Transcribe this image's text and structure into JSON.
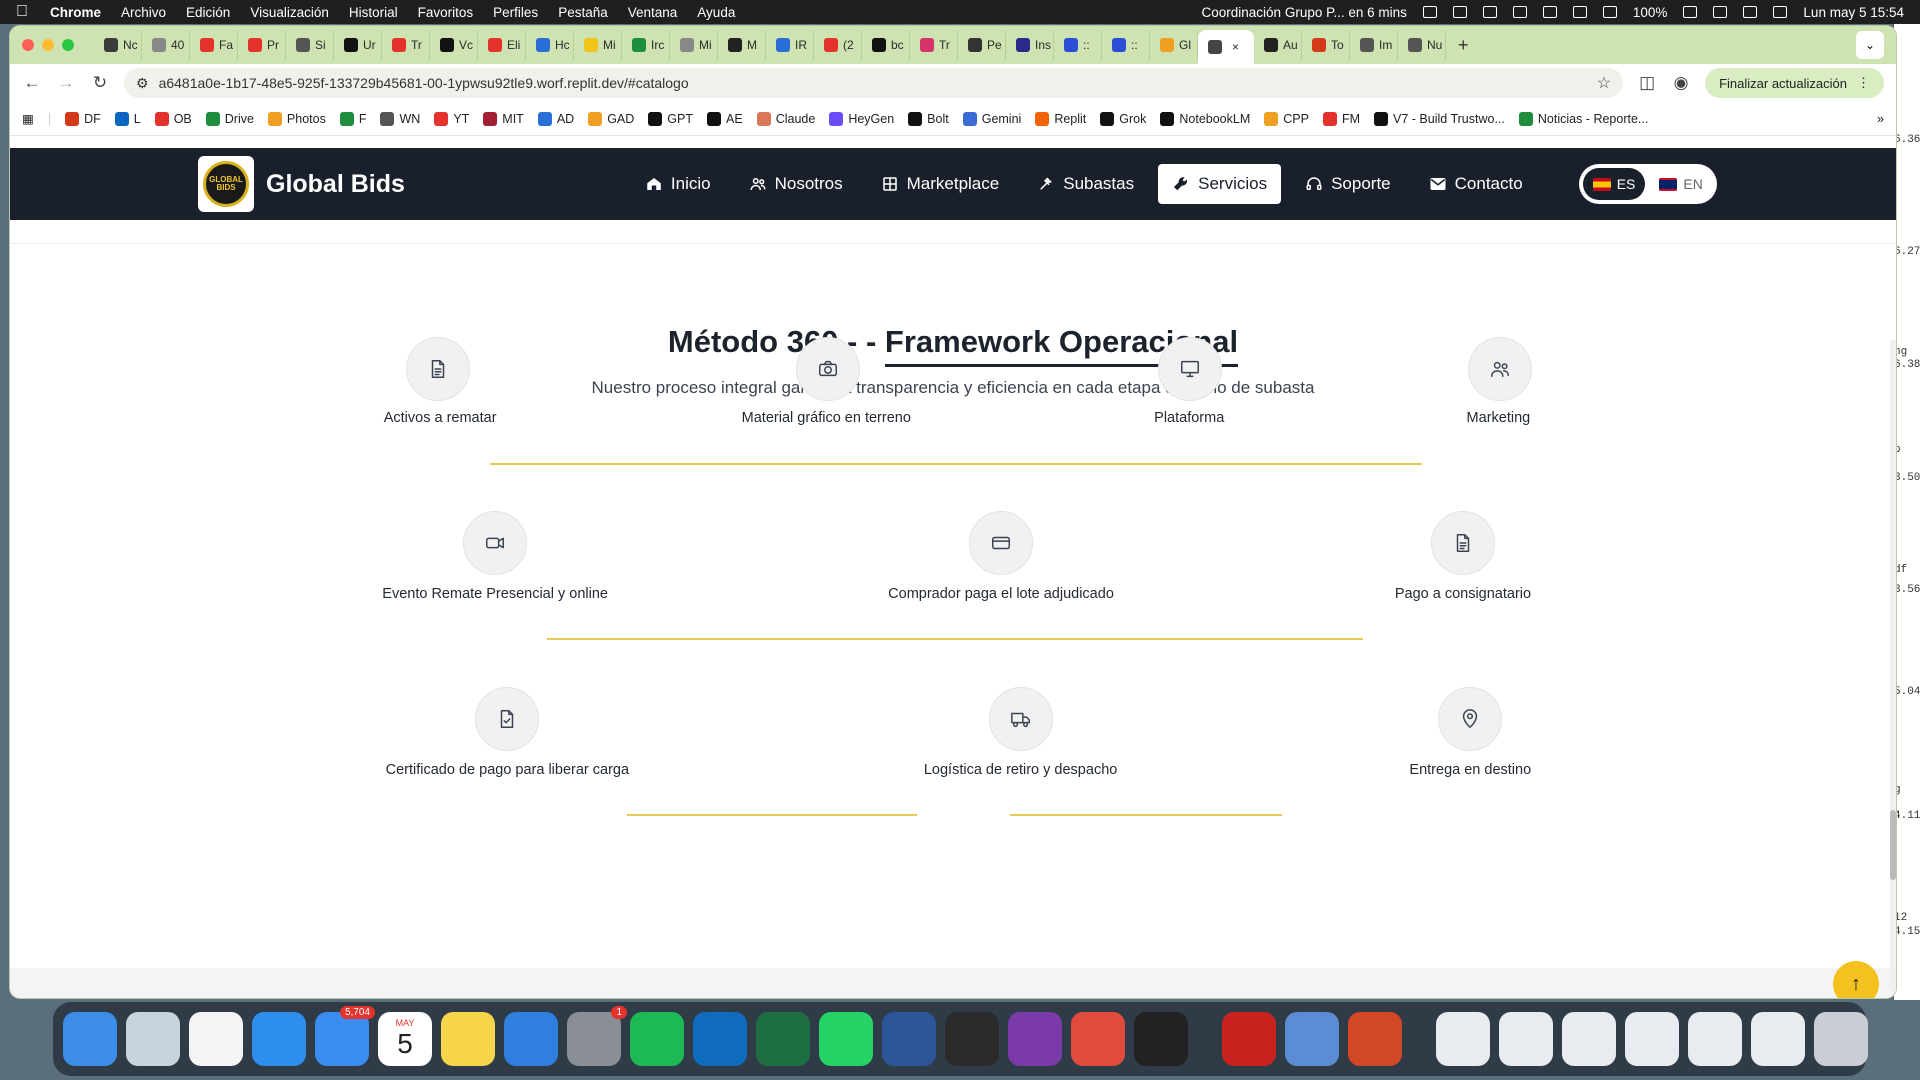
{
  "menubar": {
    "app": "Chrome",
    "items": [
      "Archivo",
      "Edición",
      "Visualización",
      "Historial",
      "Favoritos",
      "Perfiles",
      "Pestaña",
      "Ventana",
      "Ayuda"
    ],
    "event": "Coordinación Grupo P... en 6 mins",
    "battery": "100%",
    "datetime": "Lun may 5  15:54"
  },
  "tabs": [
    {
      "label": "Nc",
      "color": "#3b3b3b"
    },
    {
      "label": "40",
      "color": "#888"
    },
    {
      "label": "Fa",
      "color": "#e5322d"
    },
    {
      "label": "Pr",
      "color": "#e5322d"
    },
    {
      "label": "Si",
      "color": "#555"
    },
    {
      "label": "Ur",
      "color": "#111"
    },
    {
      "label": "Tr",
      "color": "#e5322d"
    },
    {
      "label": "Vc",
      "color": "#111"
    },
    {
      "label": "Eli",
      "color": "#e5322d"
    },
    {
      "label": "Hc",
      "color": "#2a6fd6"
    },
    {
      "label": "Mi",
      "color": "#f0c419"
    },
    {
      "label": "Irc",
      "color": "#1e8e3e"
    },
    {
      "label": "Mi",
      "color": "#888"
    },
    {
      "label": "M",
      "color": "#222"
    },
    {
      "label": "IR",
      "color": "#2a6fd6"
    },
    {
      "label": "(2",
      "color": "#e5322d"
    },
    {
      "label": "bc",
      "color": "#111"
    },
    {
      "label": "Tr",
      "color": "#d6336c"
    },
    {
      "label": "Pe",
      "color": "#333"
    },
    {
      "label": "Ins",
      "color": "#2a2a8a"
    },
    {
      "label": "::",
      "color": "#2a4fd6"
    },
    {
      "label": "::",
      "color": "#2a4fd6"
    },
    {
      "label": "Gl",
      "color": "#f0a020"
    },
    {
      "label": "",
      "color": "#444",
      "active": true
    },
    {
      "label": "Au",
      "color": "#222"
    },
    {
      "label": "To",
      "color": "#d43a1a"
    },
    {
      "label": "Im",
      "color": "#555"
    },
    {
      "label": "Nu",
      "color": "#555"
    }
  ],
  "address": {
    "url": "a6481a0e-1b17-48e5-925f-133729b45681-00-1ypwsu92tle9.worf.replit.dev/#catalogo",
    "update_button": "Finalizar actualización"
  },
  "bookmarks": [
    {
      "label": "DF",
      "color": "#d43a1a"
    },
    {
      "label": "L",
      "color": "#0a66c2"
    },
    {
      "label": "OB",
      "color": "#e5322d"
    },
    {
      "label": "Drive",
      "color": "#1e8e3e"
    },
    {
      "label": "Photos",
      "color": "#f0a020"
    },
    {
      "label": "F",
      "color": "#1e8e3e"
    },
    {
      "label": "WN",
      "color": "#555"
    },
    {
      "label": "YT",
      "color": "#e5322d"
    },
    {
      "label": "MIT",
      "color": "#a31f34"
    },
    {
      "label": "AD",
      "color": "#2a6fd6"
    },
    {
      "label": "GAD",
      "color": "#f0a020"
    },
    {
      "label": "GPT",
      "color": "#111"
    },
    {
      "label": "AE",
      "color": "#111"
    },
    {
      "label": "Claude",
      "color": "#d97757"
    },
    {
      "label": "HeyGen",
      "color": "#6b4cf6"
    },
    {
      "label": "Bolt",
      "color": "#111"
    },
    {
      "label": "Gemini",
      "color": "#3b6bd6"
    },
    {
      "label": "Replit",
      "color": "#f26207"
    },
    {
      "label": "Grok",
      "color": "#111"
    },
    {
      "label": "NotebookLM",
      "color": "#111"
    },
    {
      "label": "CPP",
      "color": "#f0a020"
    },
    {
      "label": "FM",
      "color": "#e5322d"
    },
    {
      "label": "V7 - Build Trustwo...",
      "color": "#111"
    },
    {
      "label": "Noticias - Reporte...",
      "color": "#1e8e3e"
    }
  ],
  "site": {
    "brand": "Global Bids",
    "logo_text": "GLOBAL BIDS",
    "nav": [
      {
        "label": "Inicio",
        "icon": "home-icon"
      },
      {
        "label": "Nosotros",
        "icon": "users-icon"
      },
      {
        "label": "Marketplace",
        "icon": "grid-icon"
      },
      {
        "label": "Subastas",
        "icon": "gavel-icon"
      },
      {
        "label": "Servicios",
        "icon": "wrench-icon",
        "active": true
      },
      {
        "label": "Soporte",
        "icon": "headset-icon"
      },
      {
        "label": "Contacto",
        "icon": "envelope-icon"
      }
    ],
    "lang": {
      "es": "ES",
      "en": "EN"
    },
    "title_pre": "Método 360 - - ",
    "title_underlined": "Framework Operacional",
    "subtitle": "Nuestro proceso integral garantiza transparencia y eficiencia en cada etapa del ciclo de subasta",
    "steps": [
      {
        "label": "Activos a rematar",
        "icon": "document-icon"
      },
      {
        "label": "Material gráfico en terreno",
        "icon": "camera-icon"
      },
      {
        "label": "Plataforma",
        "icon": "monitor-icon"
      },
      {
        "label": "Marketing",
        "icon": "users-icon"
      },
      {
        "label": "Evento Remate Presencial y online",
        "icon": "video-icon"
      },
      {
        "label": "Comprador paga el lote adjudicado",
        "icon": "credit-card-icon"
      },
      {
        "label": "Pago a consignatario",
        "icon": "document-icon"
      },
      {
        "label": "Certificado de pago para liberar carga",
        "icon": "file-check-icon"
      },
      {
        "label": "Logística de retiro y despacho",
        "icon": "truck-icon"
      },
      {
        "label": "Entrega en destino",
        "icon": "map-pin-icon"
      }
    ],
    "accent": "#f4c21f",
    "line_color": "#e6cb52"
  },
  "desktop_strip": [
    "6.36",
    "6.27",
    "ng",
    "6.38",
    "p",
    "3.50",
    "df",
    "3.56",
    "5.04",
    "g",
    "4.11",
    "12",
    "4.15"
  ],
  "dock": {
    "mail_badge": "5,704",
    "settings_badge": "1",
    "calendar_month": "MAY",
    "calendar_day": "5",
    "apps": [
      "finder",
      "launchpad",
      "chrome",
      "safari",
      "mail",
      "calendar",
      "notes",
      "keynote",
      "settings",
      "spotify",
      "outlook",
      "excel",
      "whatsapp",
      "word",
      "fantastical",
      "screen-recorder",
      "clipboard",
      "craft",
      "acrobat",
      "preview",
      "powerpoint"
    ]
  }
}
